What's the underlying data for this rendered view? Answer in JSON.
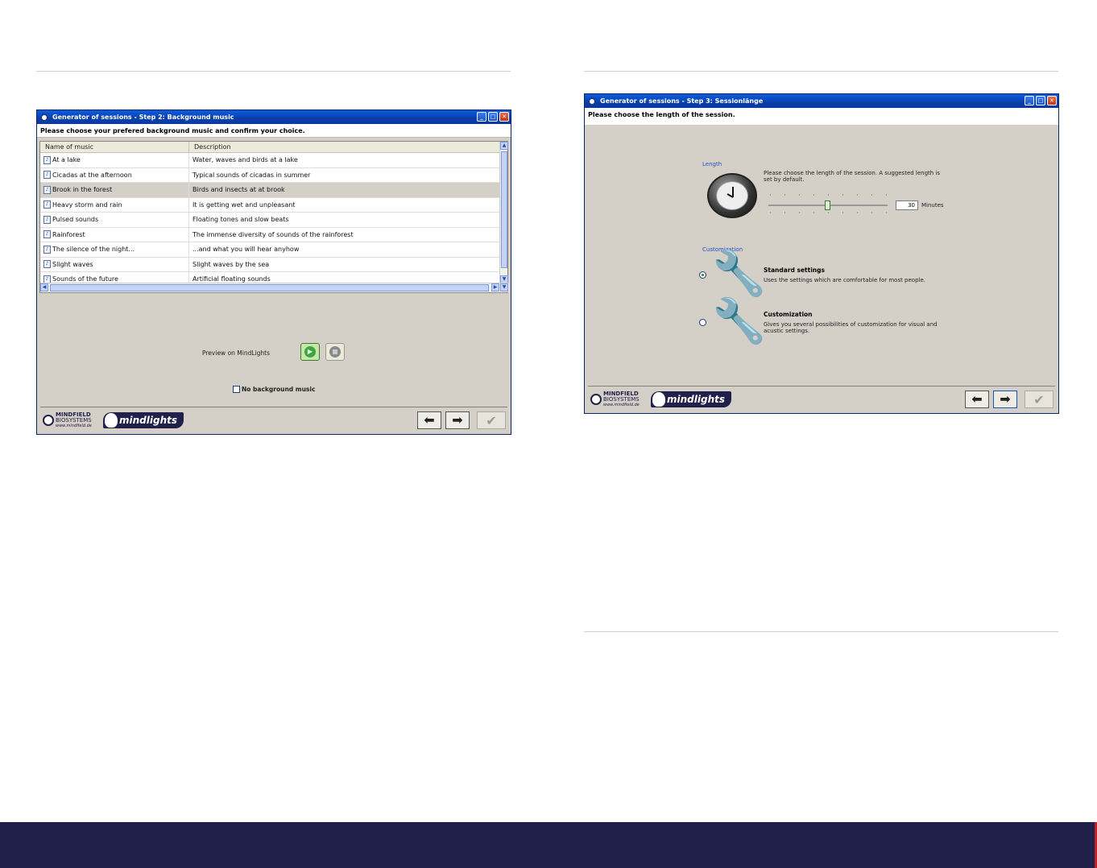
{
  "colors": {
    "titlebar": "#0a4fd0",
    "navy": "#20204a",
    "accent": "#c0202a",
    "selected_row": "#d4d0c8"
  },
  "window1": {
    "title": "Generator of sessions - Step 2: Background music",
    "instruction": "Please choose your prefered background music and confirm your choice.",
    "columns": [
      "Name of music",
      "Description"
    ],
    "rows": [
      {
        "name": "At a lake",
        "desc": "Water, waves and birds at a lake"
      },
      {
        "name": "Cicadas at the afternoon",
        "desc": "Typical sounds of cicadas in summer"
      },
      {
        "name": "Brook in the forest",
        "desc": "Birds and insects at at brook"
      },
      {
        "name": "Heavy storm and rain",
        "desc": "It is getting wet and unpleasant"
      },
      {
        "name": "Pulsed sounds",
        "desc": "Floating tones and slow beats"
      },
      {
        "name": "Rainforest",
        "desc": "The immense diversity of sounds of the rainforest"
      },
      {
        "name": "The silence of the night...",
        "desc": "...and what you will hear anyhow"
      },
      {
        "name": "Slight waves",
        "desc": "Slight waves by the sea"
      },
      {
        "name": "Sounds of the future",
        "desc": "Artificial floating sounds"
      }
    ],
    "selected_row": "Brook in the forest",
    "preview_label": "Preview on MindLights",
    "no_music_label": "No background music",
    "no_music_checked": false
  },
  "window2": {
    "title": "Generator of sessions - Step 3: Sessionlänge",
    "instruction": "Please choose the length of the session.",
    "length_label": "Length",
    "length_desc": "Please choose the length of the session. A suggested length is set by default.",
    "length_value": "30",
    "length_unit": "Minutes",
    "slider_fraction": 0.5,
    "customization_label": "Customization",
    "options": [
      {
        "title": "Standard settings",
        "desc": "Uses the settings which are comfortable for most people.",
        "selected": true
      },
      {
        "title": "Customization",
        "desc": "Gives you several possibilities of customization for visual and acustic settings.",
        "selected": false
      }
    ]
  },
  "branding": {
    "mindfield_line1": "MINDFIELD",
    "mindfield_line2": "BIOSYSTEMS",
    "mindfield_url": "www.mindfield.de",
    "mindlights": "mindlights"
  },
  "icons": {
    "play": "play-icon",
    "stop": "stop-icon",
    "back": "arrow-left-icon",
    "next": "arrow-right-icon",
    "finish": "checkmark-icon"
  }
}
